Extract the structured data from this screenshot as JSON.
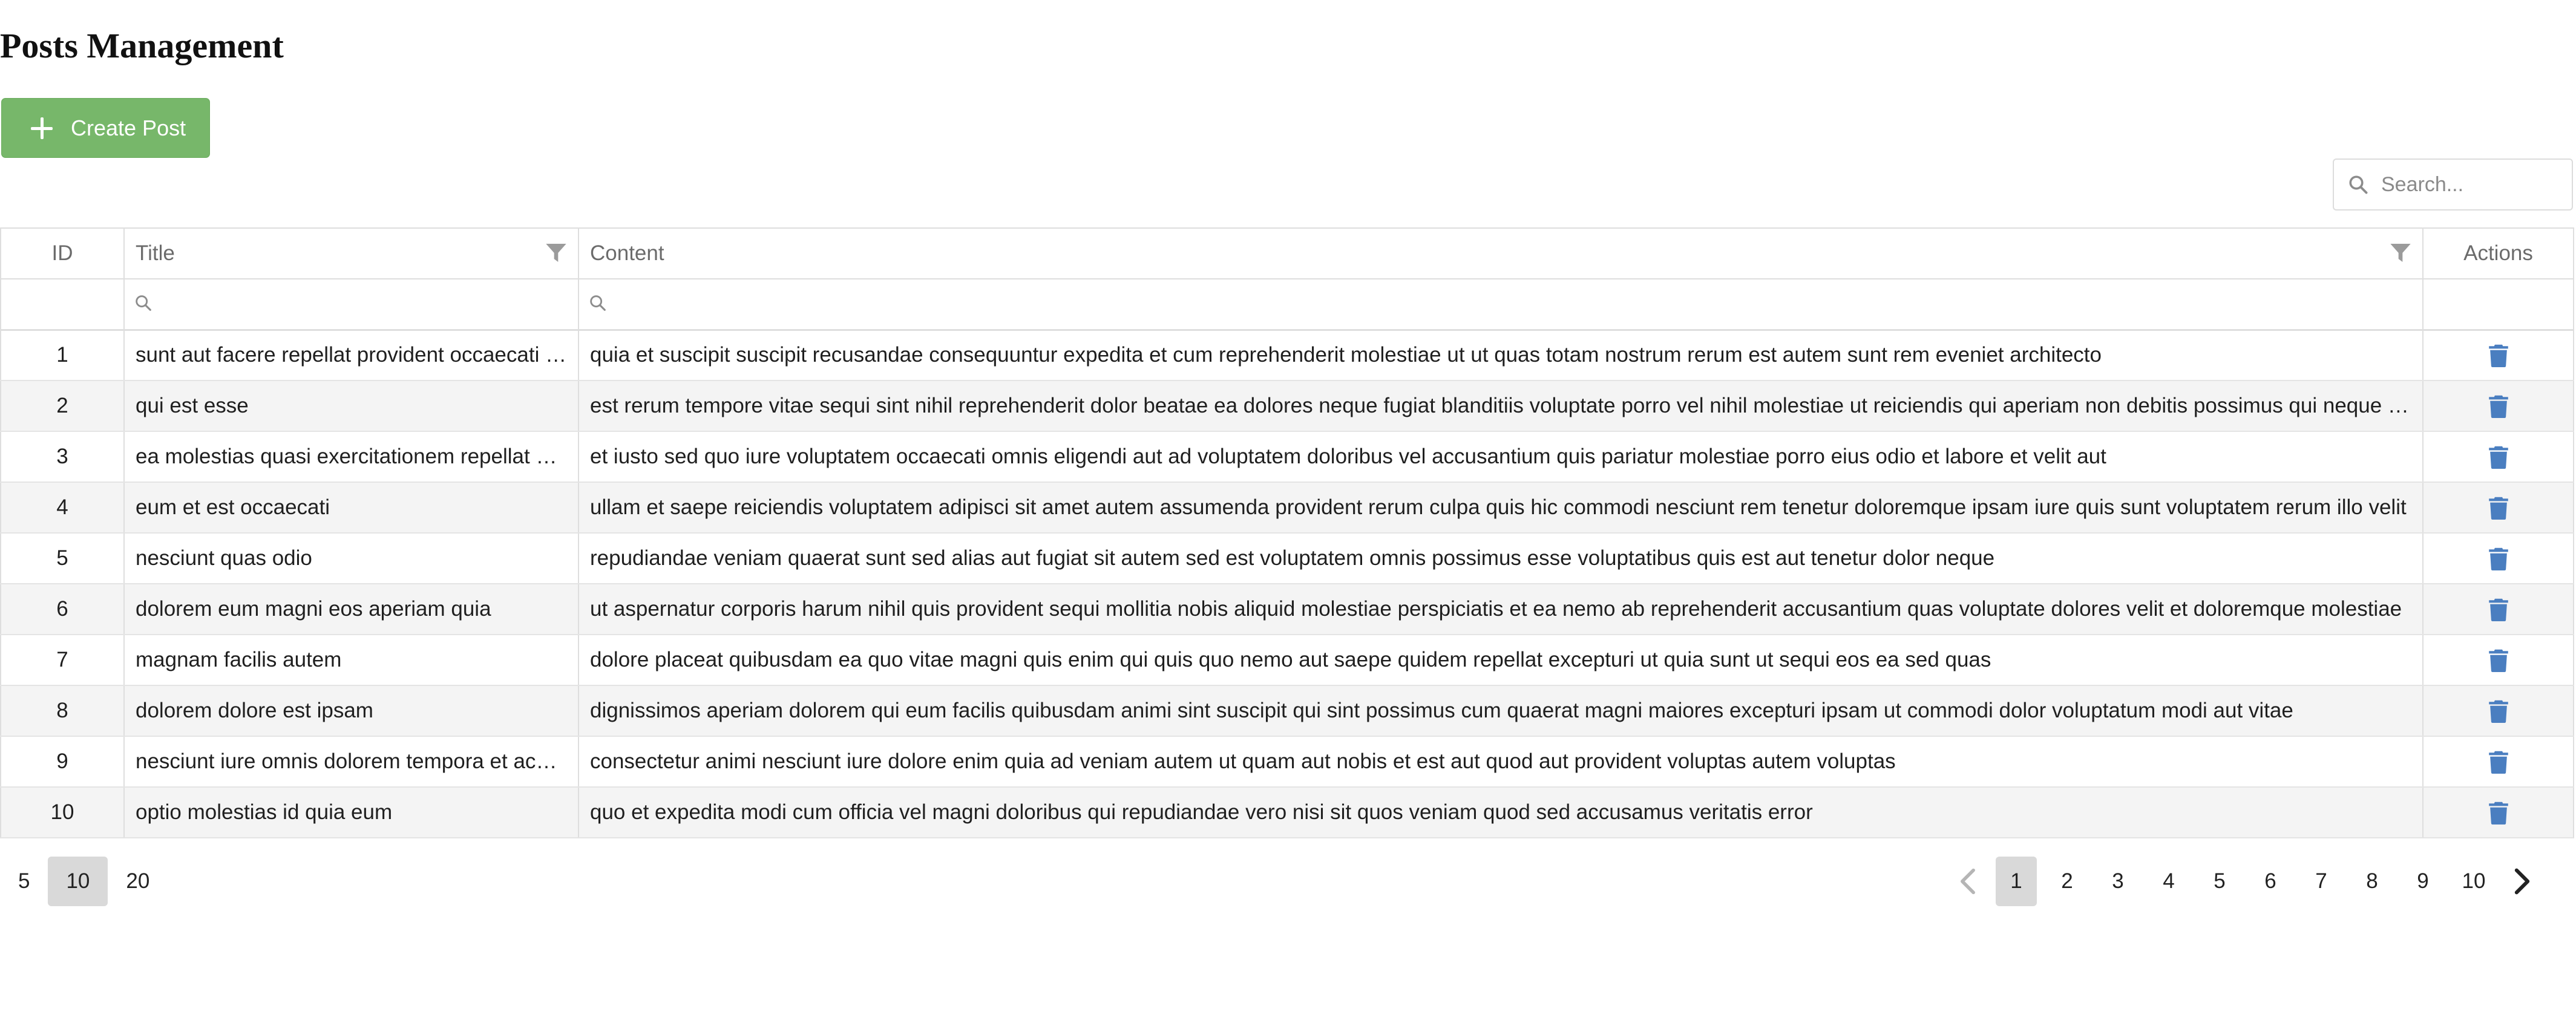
{
  "page": {
    "title": "Posts Management"
  },
  "toolbar": {
    "create_label": "Create Post",
    "create_icon": "plus-icon",
    "accent": "#77b76a"
  },
  "search": {
    "placeholder": "Search...",
    "icon": "search-icon",
    "value": ""
  },
  "table": {
    "columns": {
      "id": "ID",
      "title": "Title",
      "content": "Content",
      "actions": "Actions"
    },
    "filter_icon": "funnel-filter-icon",
    "action_icon": "trash-icon",
    "action_color": "#4a7ec0",
    "rows": [
      {
        "id": "1",
        "title": "sunt aut facere repellat provident occaecati excepturi optio reprehenderit",
        "content": "quia et suscipit suscipit recusandae consequuntur expedita et cum reprehenderit molestiae ut ut quas totam nostrum rerum est autem sunt rem eveniet architecto"
      },
      {
        "id": "2",
        "title": "qui est esse",
        "content": "est rerum tempore vitae sequi sint nihil reprehenderit dolor beatae ea dolores neque fugiat blanditiis voluptate porro vel nihil molestiae ut reiciendis qui aperiam non debitis possimus qui neque nisi nulla"
      },
      {
        "id": "3",
        "title": "ea molestias quasi exercitationem repellat qui ipsa sit aut",
        "content": "et iusto sed quo iure voluptatem occaecati omnis eligendi aut ad voluptatem doloribus vel accusantium quis pariatur molestiae porro eius odio et labore et velit aut"
      },
      {
        "id": "4",
        "title": "eum et est occaecati",
        "content": "ullam et saepe reiciendis voluptatem adipisci sit amet autem assumenda provident rerum culpa quis hic commodi nesciunt rem tenetur doloremque ipsam iure quis sunt voluptatem rerum illo velit"
      },
      {
        "id": "5",
        "title": "nesciunt quas odio",
        "content": "repudiandae veniam quaerat sunt sed alias aut fugiat sit autem sed est voluptatem omnis possimus esse voluptatibus quis est aut tenetur dolor neque"
      },
      {
        "id": "6",
        "title": "dolorem eum magni eos aperiam quia",
        "content": "ut aspernatur corporis harum nihil quis provident sequi mollitia nobis aliquid molestiae perspiciatis et ea nemo ab reprehenderit accusantium quas voluptate dolores velit et doloremque molestiae"
      },
      {
        "id": "7",
        "title": "magnam facilis autem",
        "content": "dolore placeat quibusdam ea quo vitae magni quis enim qui quis quo nemo aut saepe quidem repellat excepturi ut quia sunt ut sequi eos ea sed quas"
      },
      {
        "id": "8",
        "title": "dolorem dolore est ipsam",
        "content": "dignissimos aperiam dolorem qui eum facilis quibusdam animi sint suscipit qui sint possimus cum quaerat magni maiores excepturi ipsam ut commodi dolor voluptatum modi aut vitae"
      },
      {
        "id": "9",
        "title": "nesciunt iure omnis dolorem tempora et accusantium",
        "content": "consectetur animi nesciunt iure dolore enim quia ad veniam autem ut quam aut nobis et est aut quod aut provident voluptas autem voluptas"
      },
      {
        "id": "10",
        "title": "optio molestias id quia eum",
        "content": "quo et expedita modi cum officia vel magni doloribus qui repudiandae vero nisi sit quos veniam quod sed accusamus veritatis error"
      }
    ]
  },
  "page_size": {
    "options": [
      "5",
      "10",
      "20"
    ],
    "selected": "10"
  },
  "pagination": {
    "pages": [
      "1",
      "2",
      "3",
      "4",
      "5",
      "6",
      "7",
      "8",
      "9",
      "10"
    ],
    "current": "1",
    "prev_icon": "chevron-left-icon",
    "next_icon": "chevron-right-icon"
  }
}
